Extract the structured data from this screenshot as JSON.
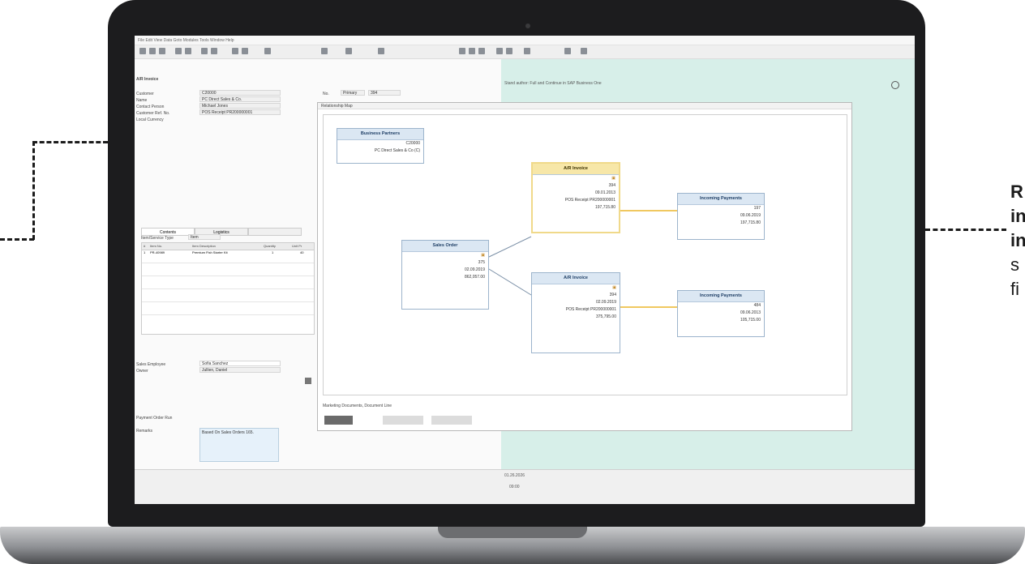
{
  "caption": {
    "bold_lines": [
      "R",
      "in",
      "in"
    ],
    "lines": [
      "s",
      "fi"
    ]
  },
  "sap": {
    "menu": "File  Edit  View  Data  Goto  Modules  Tools  Window  Help",
    "form_title": "A/R Invoice",
    "fields": [
      {
        "label": "Customer",
        "value": "C20000"
      },
      {
        "label": "Name",
        "value": "PC Direct Sales & Co."
      },
      {
        "label": "Contact Person",
        "value": "Michael Jones"
      },
      {
        "label": "Customer Ref. No.",
        "value": "POS Receipt PR200000001"
      },
      {
        "label": "Local Currency",
        "value": ""
      }
    ],
    "header_right": {
      "no_label": "No.",
      "no_value": "Primary",
      "doc_no": "394"
    },
    "tabs": [
      "Contents",
      "Logistics",
      ""
    ],
    "grid": {
      "item_service_type_label": "Item/Service Type",
      "item_service_type_value": "Item",
      "columns": [
        "#",
        "Item No.",
        "Item Description",
        "Quantity",
        "Unit Pr"
      ],
      "rows": [
        [
          "1",
          "PR-40989",
          "Premium Fish Starter Kit",
          "1",
          "40"
        ]
      ]
    },
    "sales_employee_label": "Sales Employee",
    "sales_employee_value": "Sofia Sanchez",
    "owner_label": "Owner",
    "owner_value": "Jullien, Daniel",
    "payment_checkbox": "Payment Order Run",
    "remarks_label": "Remarks",
    "remarks_value": "Based On Sales Orders 165.",
    "teal_note": "Stand author: Full and Continue in SAP Business One",
    "bottom_dropdown": "Marketing Documents, Document Line",
    "status_date": "01.26.2026",
    "status_time": "09:00"
  },
  "relationship_map": {
    "title": "Relationship Map",
    "nodes": [
      {
        "id": "bp",
        "title": "Business Partners",
        "lines": [
          "C20000",
          "PC Direct Sales & Co (C)"
        ],
        "highlight": false
      },
      {
        "id": "so",
        "title": "Sales Order",
        "lines": [
          "375",
          "02.09.2019",
          "862,057.00"
        ],
        "highlight": false
      },
      {
        "id": "ar1",
        "title": "A/R Invoice",
        "lines": [
          "394",
          "09.01.2013",
          "POS Receipt PR200000001",
          "197,715.80"
        ],
        "highlight": true
      },
      {
        "id": "ar2",
        "title": "A/R Invoice",
        "lines": [
          "394",
          "02.09.2019",
          "POS Receipt PR200000001",
          "375,795.00"
        ],
        "highlight": false
      },
      {
        "id": "ip1",
        "title": "Incoming Payments",
        "lines": [
          "197",
          "09.06.2019",
          "197,715.80"
        ],
        "highlight": false
      },
      {
        "id": "ip2",
        "title": "Incoming Payments",
        "lines": [
          "484",
          "09.06.2013",
          "105,715.00"
        ],
        "highlight": false
      }
    ]
  }
}
